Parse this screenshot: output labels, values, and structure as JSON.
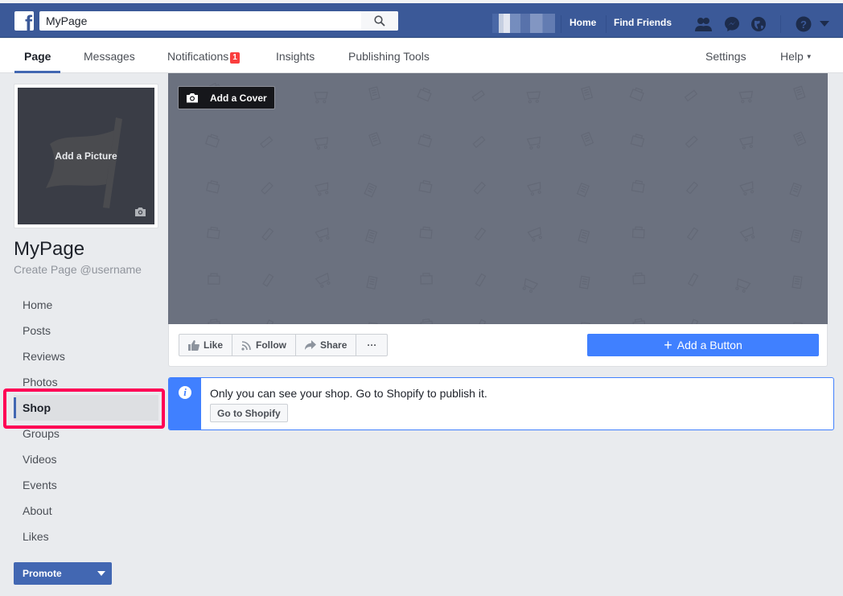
{
  "topbar": {
    "search_value": "MyPage",
    "search_placeholder": "Search",
    "links": [
      "Home",
      "Find Friends"
    ],
    "icons": [
      "friend-requests-icon",
      "messenger-icon",
      "notifications-globe-icon",
      "help-icon",
      "account-menu-caret-icon"
    ]
  },
  "pagenav": {
    "tabs": [
      {
        "label": "Page",
        "active": true
      },
      {
        "label": "Messages"
      },
      {
        "label": "Notifications",
        "badge": "1"
      },
      {
        "label": "Insights"
      },
      {
        "label": "Publishing Tools"
      }
    ],
    "right": [
      {
        "label": "Settings"
      },
      {
        "label": "Help"
      }
    ]
  },
  "profile": {
    "add_picture_label": "Add a Picture",
    "name": "MyPage",
    "username_prompt": "Create Page @username"
  },
  "sidebar": {
    "items": [
      {
        "label": "Home"
      },
      {
        "label": "Posts"
      },
      {
        "label": "Reviews"
      },
      {
        "label": "Photos"
      },
      {
        "label": "Shop",
        "active": true,
        "highlighted": true
      },
      {
        "label": "Groups"
      },
      {
        "label": "Videos"
      },
      {
        "label": "Events"
      },
      {
        "label": "About"
      },
      {
        "label": "Likes"
      }
    ],
    "promote_label": "Promote"
  },
  "cover": {
    "add_cover_label": "Add a Cover"
  },
  "actions": {
    "like": "Like",
    "follow": "Follow",
    "share": "Share",
    "more": "···",
    "add_button": "Add a Button"
  },
  "notice": {
    "text": "Only you can see your shop. Go to Shopify to publish it.",
    "button": "Go to Shopify"
  },
  "colors": {
    "brand_blue": "#3b5998",
    "accent_blue": "#4080ff",
    "highlight": "#ff0055",
    "badge_red": "#fa3e3e"
  }
}
